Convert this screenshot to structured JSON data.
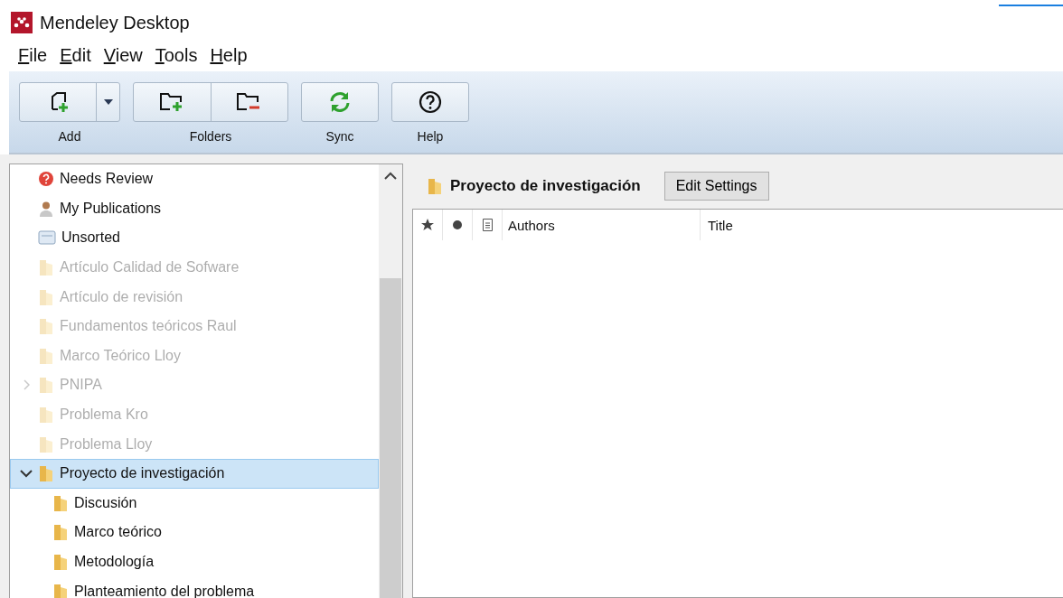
{
  "window": {
    "title": "Mendeley Desktop"
  },
  "menu": [
    {
      "label": "File"
    },
    {
      "label": "Edit"
    },
    {
      "label": "View"
    },
    {
      "label": "Tools"
    },
    {
      "label": "Help"
    }
  ],
  "toolbar": [
    {
      "label": "Add",
      "buttons": [
        {
          "kind": "add"
        },
        {
          "kind": "dropdown"
        }
      ]
    },
    {
      "label": "Folders",
      "buttons": [
        {
          "kind": "new-folder"
        },
        {
          "kind": "remove-folder"
        }
      ]
    },
    {
      "label": "Sync",
      "buttons": [
        {
          "kind": "sync"
        }
      ]
    },
    {
      "label": "Help",
      "buttons": [
        {
          "kind": "help"
        }
      ]
    }
  ],
  "sidebar": {
    "items": [
      {
        "label": "Needs Review",
        "kind": "review",
        "faded": false,
        "selected": false
      },
      {
        "label": "My Publications",
        "kind": "person",
        "faded": false,
        "selected": false
      },
      {
        "label": "Unsorted",
        "kind": "inbox",
        "faded": false,
        "selected": false
      },
      {
        "label": "Artículo Calidad de Sofware",
        "kind": "folder",
        "faded": true,
        "selected": false
      },
      {
        "label": "Artículo de revisión",
        "kind": "folder",
        "faded": true,
        "selected": false
      },
      {
        "label": "Fundamentos teóricos Raul",
        "kind": "folder",
        "faded": true,
        "selected": false
      },
      {
        "label": "Marco Teórico Lloy",
        "kind": "folder",
        "faded": true,
        "selected": false
      },
      {
        "label": "PNIPA",
        "kind": "folder",
        "faded": true,
        "selected": false,
        "expanded": false
      },
      {
        "label": "Problema Kro",
        "kind": "folder",
        "faded": true,
        "selected": false
      },
      {
        "label": "Problema Lloy",
        "kind": "folder",
        "faded": true,
        "selected": false
      },
      {
        "label": "Proyecto de investigación",
        "kind": "folder",
        "faded": false,
        "selected": true,
        "expanded": true,
        "children": [
          {
            "label": "Discusión",
            "kind": "folder",
            "faded": false,
            "selected": false
          },
          {
            "label": "Marco teórico",
            "kind": "folder",
            "faded": false,
            "selected": false
          },
          {
            "label": "Metodología",
            "kind": "folder",
            "faded": false,
            "selected": false
          },
          {
            "label": "Planteamiento del problema",
            "kind": "folder",
            "faded": false,
            "selected": false
          }
        ]
      }
    ]
  },
  "content": {
    "title": "Proyecto de investigación",
    "edit_button": "Edit Settings",
    "table": {
      "columns": [
        {
          "kind": "star"
        },
        {
          "kind": "dot"
        },
        {
          "kind": "document"
        },
        {
          "kind": "text",
          "label": "Authors"
        },
        {
          "kind": "text",
          "label": "Title"
        }
      ]
    }
  }
}
